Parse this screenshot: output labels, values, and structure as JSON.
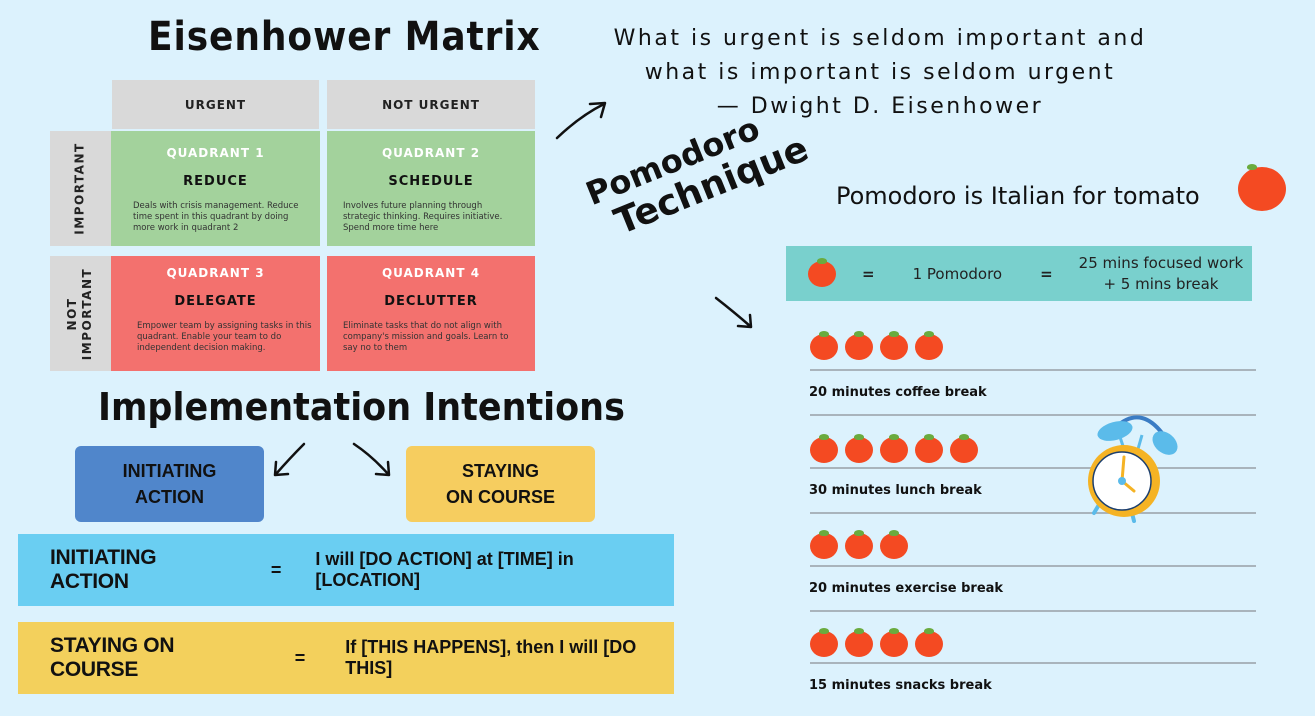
{
  "eisenhower": {
    "title": "Eisenhower Matrix",
    "col_headers": [
      "URGENT",
      "NOT URGENT"
    ],
    "row_headers": [
      "IMPORTANT",
      "NOT\nIMPORTANT"
    ],
    "quadrants": [
      {
        "name": "QUADRANT 1",
        "action": "REDUCE",
        "desc": "Deals with crisis management. Reduce time spent in this quadrant by doing more work in quadrant 2",
        "color": "#a3d29c"
      },
      {
        "name": "QUADRANT 2",
        "action": "SCHEDULE",
        "desc": "Involves future planning through strategic thinking. Requires initiative. Spend more time here",
        "color": "#a3d29c"
      },
      {
        "name": "QUADRANT 3",
        "action": "DELEGATE",
        "desc": "Empower team by assigning tasks in this quadrant. Enable your team to do independent decision making.",
        "color": "#f3716e"
      },
      {
        "name": "QUADRANT 4",
        "action": "DECLUTTER",
        "desc": "Eliminate tasks that do not align with company's mission and goals. Learn to say no to them",
        "color": "#f3716e"
      }
    ]
  },
  "quote": {
    "line1": "What is urgent is seldom important and",
    "line2": "what is important is seldom urgent",
    "author": "— Dwight D. Eisenhower"
  },
  "pomodoro": {
    "title_line1": "Pomodoro",
    "title_line2": "Technique",
    "fact": "Pomodoro is Italian for tomato",
    "equation": {
      "eq1": "=",
      "unit": "1 Pomodoro",
      "eq2": "=",
      "definition_line1": "25 mins focused work",
      "definition_line2": "+ 5 mins break"
    },
    "breaks": [
      {
        "tomatoes": 4,
        "label": "20 minutes coffee break"
      },
      {
        "tomatoes": 5,
        "label": "30 minutes lunch break"
      },
      {
        "tomatoes": 3,
        "label": "20 minutes exercise break"
      },
      {
        "tomatoes": 4,
        "label": "15 minutes snacks break"
      }
    ]
  },
  "implementation": {
    "title": "Implementation Intentions",
    "boxes": [
      {
        "label": "INITIATING\nACTION",
        "color": "#5086cb"
      },
      {
        "label": "STAYING\nON COURSE",
        "color": "#f6cd5f"
      }
    ],
    "formulas": [
      {
        "label": "INITIATING ACTION",
        "eq": "=",
        "value": "I will [DO ACTION] at [TIME] in [LOCATION]",
        "color": "#6acef2"
      },
      {
        "label": "STAYING ON COURSE",
        "eq": "=",
        "value": "If [THIS HAPPENS], then I will [DO THIS]",
        "color": "#f3d05c"
      }
    ]
  }
}
